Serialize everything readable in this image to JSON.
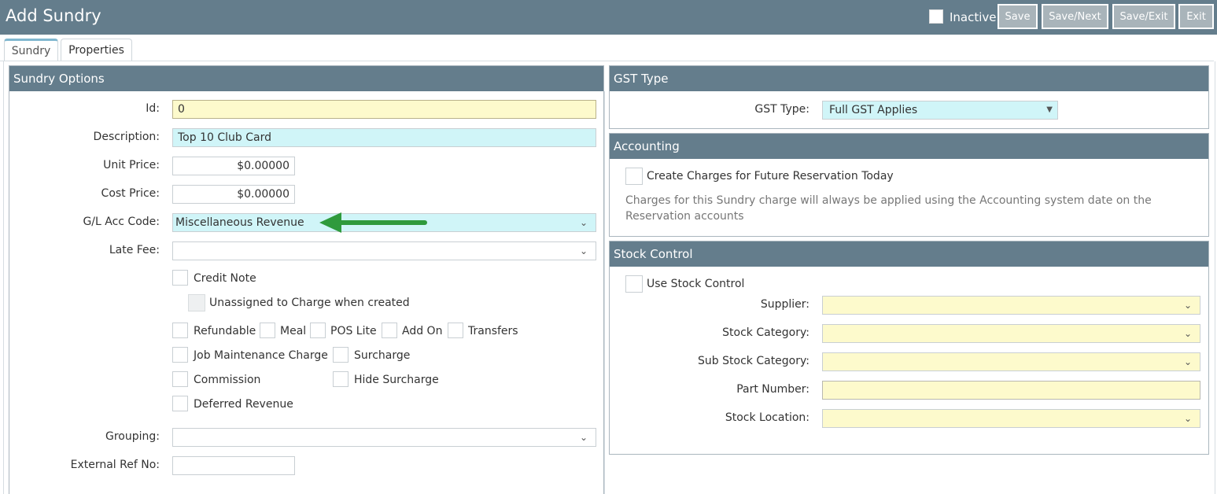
{
  "header": {
    "title": "Add Sundry",
    "inactive_label": "Inactive",
    "buttons": {
      "save": "Save",
      "save_next": "Save/Next",
      "save_exit": "Save/Exit",
      "exit": "Exit"
    }
  },
  "tabs": [
    {
      "label": "Sundry"
    },
    {
      "label": "Properties"
    }
  ],
  "sundry_options": {
    "title": "Sundry Options",
    "id": {
      "label": "Id:",
      "value": "0"
    },
    "description": {
      "label": "Description:",
      "value": "Top 10 Club Card"
    },
    "unit_price": {
      "label": "Unit Price:",
      "value": "$0.00000"
    },
    "cost_price": {
      "label": "Cost Price:",
      "value": "$0.00000"
    },
    "gl_acc_code": {
      "label": "G/L Acc Code:",
      "value": "Miscellaneous Revenue"
    },
    "late_fee": {
      "label": "Late Fee:",
      "value": ""
    },
    "checkboxes": {
      "credit_note": "Credit Note",
      "unassigned": "Unassigned to Charge when created",
      "refundable": "Refundable",
      "meal": "Meal",
      "pos_lite": "POS Lite",
      "add_on": "Add On",
      "transfers": "Transfers",
      "job_maintenance": "Job Maintenance Charge",
      "surcharge": "Surcharge",
      "commission": "Commission",
      "hide_surcharge": "Hide Surcharge",
      "deferred_revenue": "Deferred Revenue"
    },
    "grouping": {
      "label": "Grouping:",
      "value": ""
    },
    "external_ref": {
      "label": "External Ref No:",
      "value": ""
    }
  },
  "gst": {
    "title": "GST Type",
    "label": "GST Type:",
    "value": "Full GST Applies"
  },
  "accounting": {
    "title": "Accounting",
    "checkbox_label": "Create Charges for Future Reservation Today",
    "note_line1": "Charges for this Sundry charge will always be applied using the Accounting system date on the",
    "note_line2": "Reservation accounts"
  },
  "stock_control": {
    "title": "Stock Control",
    "use_label": "Use Stock Control",
    "supplier": {
      "label": "Supplier:",
      "value": ""
    },
    "stock_category": {
      "label": "Stock Category:",
      "value": ""
    },
    "sub_stock_category": {
      "label": "Sub Stock Category:",
      "value": ""
    },
    "part_number": {
      "label": "Part Number:",
      "value": ""
    },
    "stock_location": {
      "label": "Stock Location:",
      "value": ""
    }
  },
  "colors": {
    "header": "#647d8c",
    "required_field": "#fdfacc",
    "highlight_field": "#d0f5f8",
    "annotation_arrow": "#2f9a3c"
  },
  "icons": {
    "dropdown": "chevron-down-icon",
    "select_arrow": "triangle-down-icon",
    "annotation": "green-arrow-icon"
  }
}
